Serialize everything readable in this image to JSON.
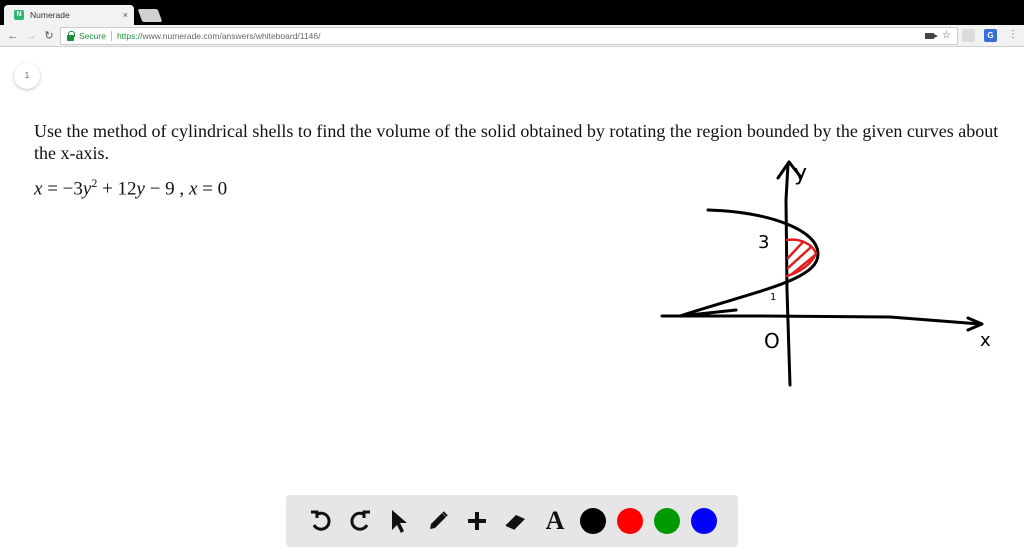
{
  "browser": {
    "tab_title": "Numerade",
    "tab_close": "×",
    "favicon_letter": "N",
    "secure_label": "Secure",
    "url_scheme": "https://",
    "url_host": "www.numerade.com",
    "url_path": "/answers/whiteboard/1146/",
    "ext_letter": "G"
  },
  "whiteboard": {
    "page_number": "1",
    "problem_text": "Use the method of cylindrical shells to find the volume of the solid obtained by rotating the region bounded by the given curves about the x-axis.",
    "equation": {
      "lhs": "x",
      "rhs1": "= −3",
      "var1": "y",
      "exp": "2",
      "rhs2": " + 12",
      "var2": "y",
      "rhs3": " − 9 ,",
      "lhs2": "x",
      "rhs4": " = 0"
    },
    "sketch_labels": {
      "y_axis": "y",
      "x_axis": "x",
      "origin": "O",
      "mark_3": "3",
      "mark_1": "1"
    }
  },
  "drawing_toolbar": {
    "text_tool": "A",
    "colors": {
      "black": "#000000",
      "red": "#ff0000",
      "green": "#009900",
      "blue": "#0000ff"
    },
    "shading_color": "#e02020"
  }
}
